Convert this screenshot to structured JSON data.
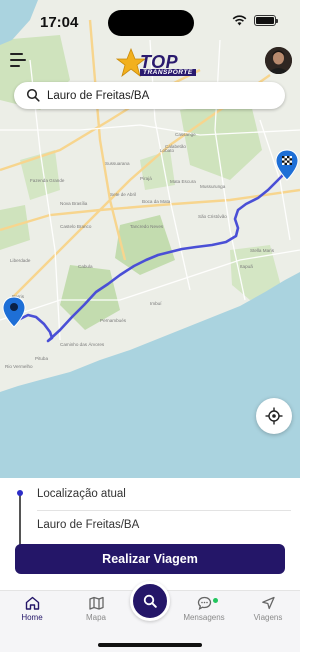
{
  "status_bar": {
    "time": "17:04"
  },
  "header": {
    "logo_text": "TOP",
    "logo_subtext": "TRANSPORTE"
  },
  "search": {
    "value": "Lauro de Freitas/BA"
  },
  "map": {
    "labels": [
      "Lobato",
      "Calabetão",
      "Sussuarana",
      "Fazenda Grande",
      "Castelo Branco",
      "Pirajá",
      "Liberdade",
      "Cabula",
      "Mata Escura",
      "Tancredo Neves",
      "Pernambués",
      "Imbuí",
      "Caminho das Árvores",
      "Rio Vermelho",
      "Pituba",
      "Itapuã",
      "Stella Maris",
      "São Cristóvão",
      "Boca da Mata",
      "Cassange",
      "Sete de Abril",
      "Barris",
      "Mussurunga",
      "Nova Brasília"
    ]
  },
  "route_panel": {
    "origin": "Localização atual",
    "destination": "Lauro de Freitas/BA",
    "button_label": "Realizar Viagem"
  },
  "tabs": [
    {
      "label": "Home",
      "icon": "home-icon"
    },
    {
      "label": "Mapa",
      "icon": "map-icon"
    },
    {
      "label": "Mensagens",
      "icon": "messages-icon"
    },
    {
      "label": "Viagens",
      "icon": "navigation-icon"
    }
  ],
  "colors": {
    "brand": "#241668",
    "route": "#4a4fd6",
    "pin": "#1e6fd6",
    "notification": "#22c55e"
  }
}
